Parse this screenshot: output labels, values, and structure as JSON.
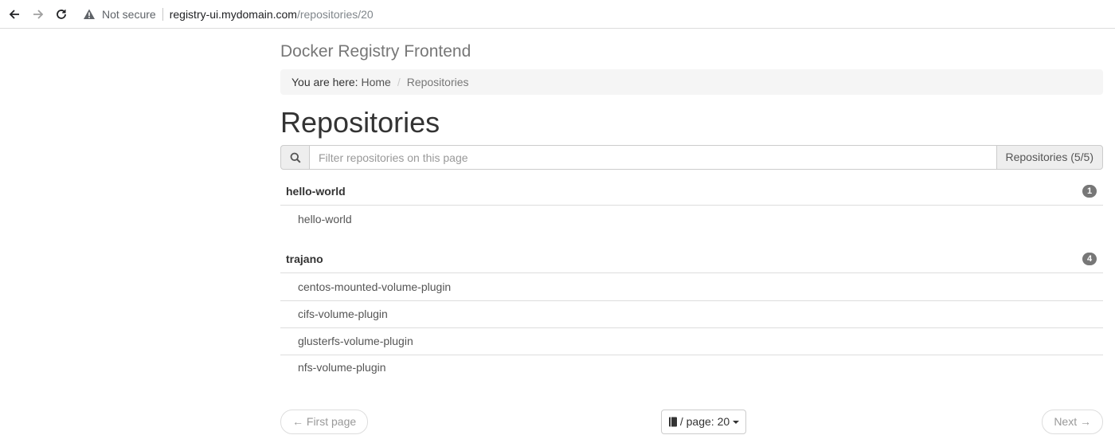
{
  "browser": {
    "security_label": "Not secure",
    "url_host": "registry-ui.mydomain.com",
    "url_path": "/repositories/20"
  },
  "app": {
    "brand": "Docker Registry Frontend"
  },
  "breadcrumb": {
    "prefix": "You are here:",
    "home": "Home",
    "divider": "/",
    "current": "Repositories"
  },
  "page_title": "Repositories",
  "filter": {
    "placeholder": "Filter repositories on this page",
    "value": "",
    "count_label": "Repositories (5/5)"
  },
  "groups": [
    {
      "name": "hello-world",
      "count": "1",
      "repos": [
        "hello-world"
      ]
    },
    {
      "name": "trajano",
      "count": "4",
      "repos": [
        "centos-mounted-volume-plugin",
        "cifs-volume-plugin",
        "glusterfs-volume-plugin",
        "nfs-volume-plugin"
      ]
    }
  ],
  "pager": {
    "first_label": "← First page",
    "per_page_label": "/ page: 20",
    "next_label": "Next →"
  },
  "icons": [
    "back-icon",
    "forward-icon",
    "reload-icon",
    "warning-icon",
    "search-icon",
    "book-icon",
    "caret-down-icon"
  ],
  "colors": {
    "badge": "#777777",
    "breadcrumb_bg": "#f5f5f5",
    "addon_bg": "#eeeeee"
  }
}
